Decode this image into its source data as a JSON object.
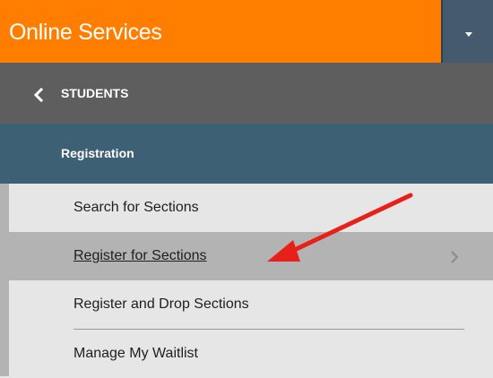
{
  "header": {
    "title": "Online Services",
    "toggle_icon": "caret-down-icon",
    "brand_color": "#ff7e00"
  },
  "nav": {
    "back_icon": "chevron-left-icon",
    "section_label": "STUDENTS",
    "category_label": "Registration"
  },
  "menu": {
    "items": [
      {
        "label": "Search for Sections",
        "active": false
      },
      {
        "label": "Register for Sections",
        "active": true
      },
      {
        "label": "Register and Drop Sections",
        "active": false
      },
      {
        "label": "Manage My Waitlist",
        "active": false
      }
    ]
  },
  "annotation": {
    "arrow_color": "#e8201a"
  }
}
